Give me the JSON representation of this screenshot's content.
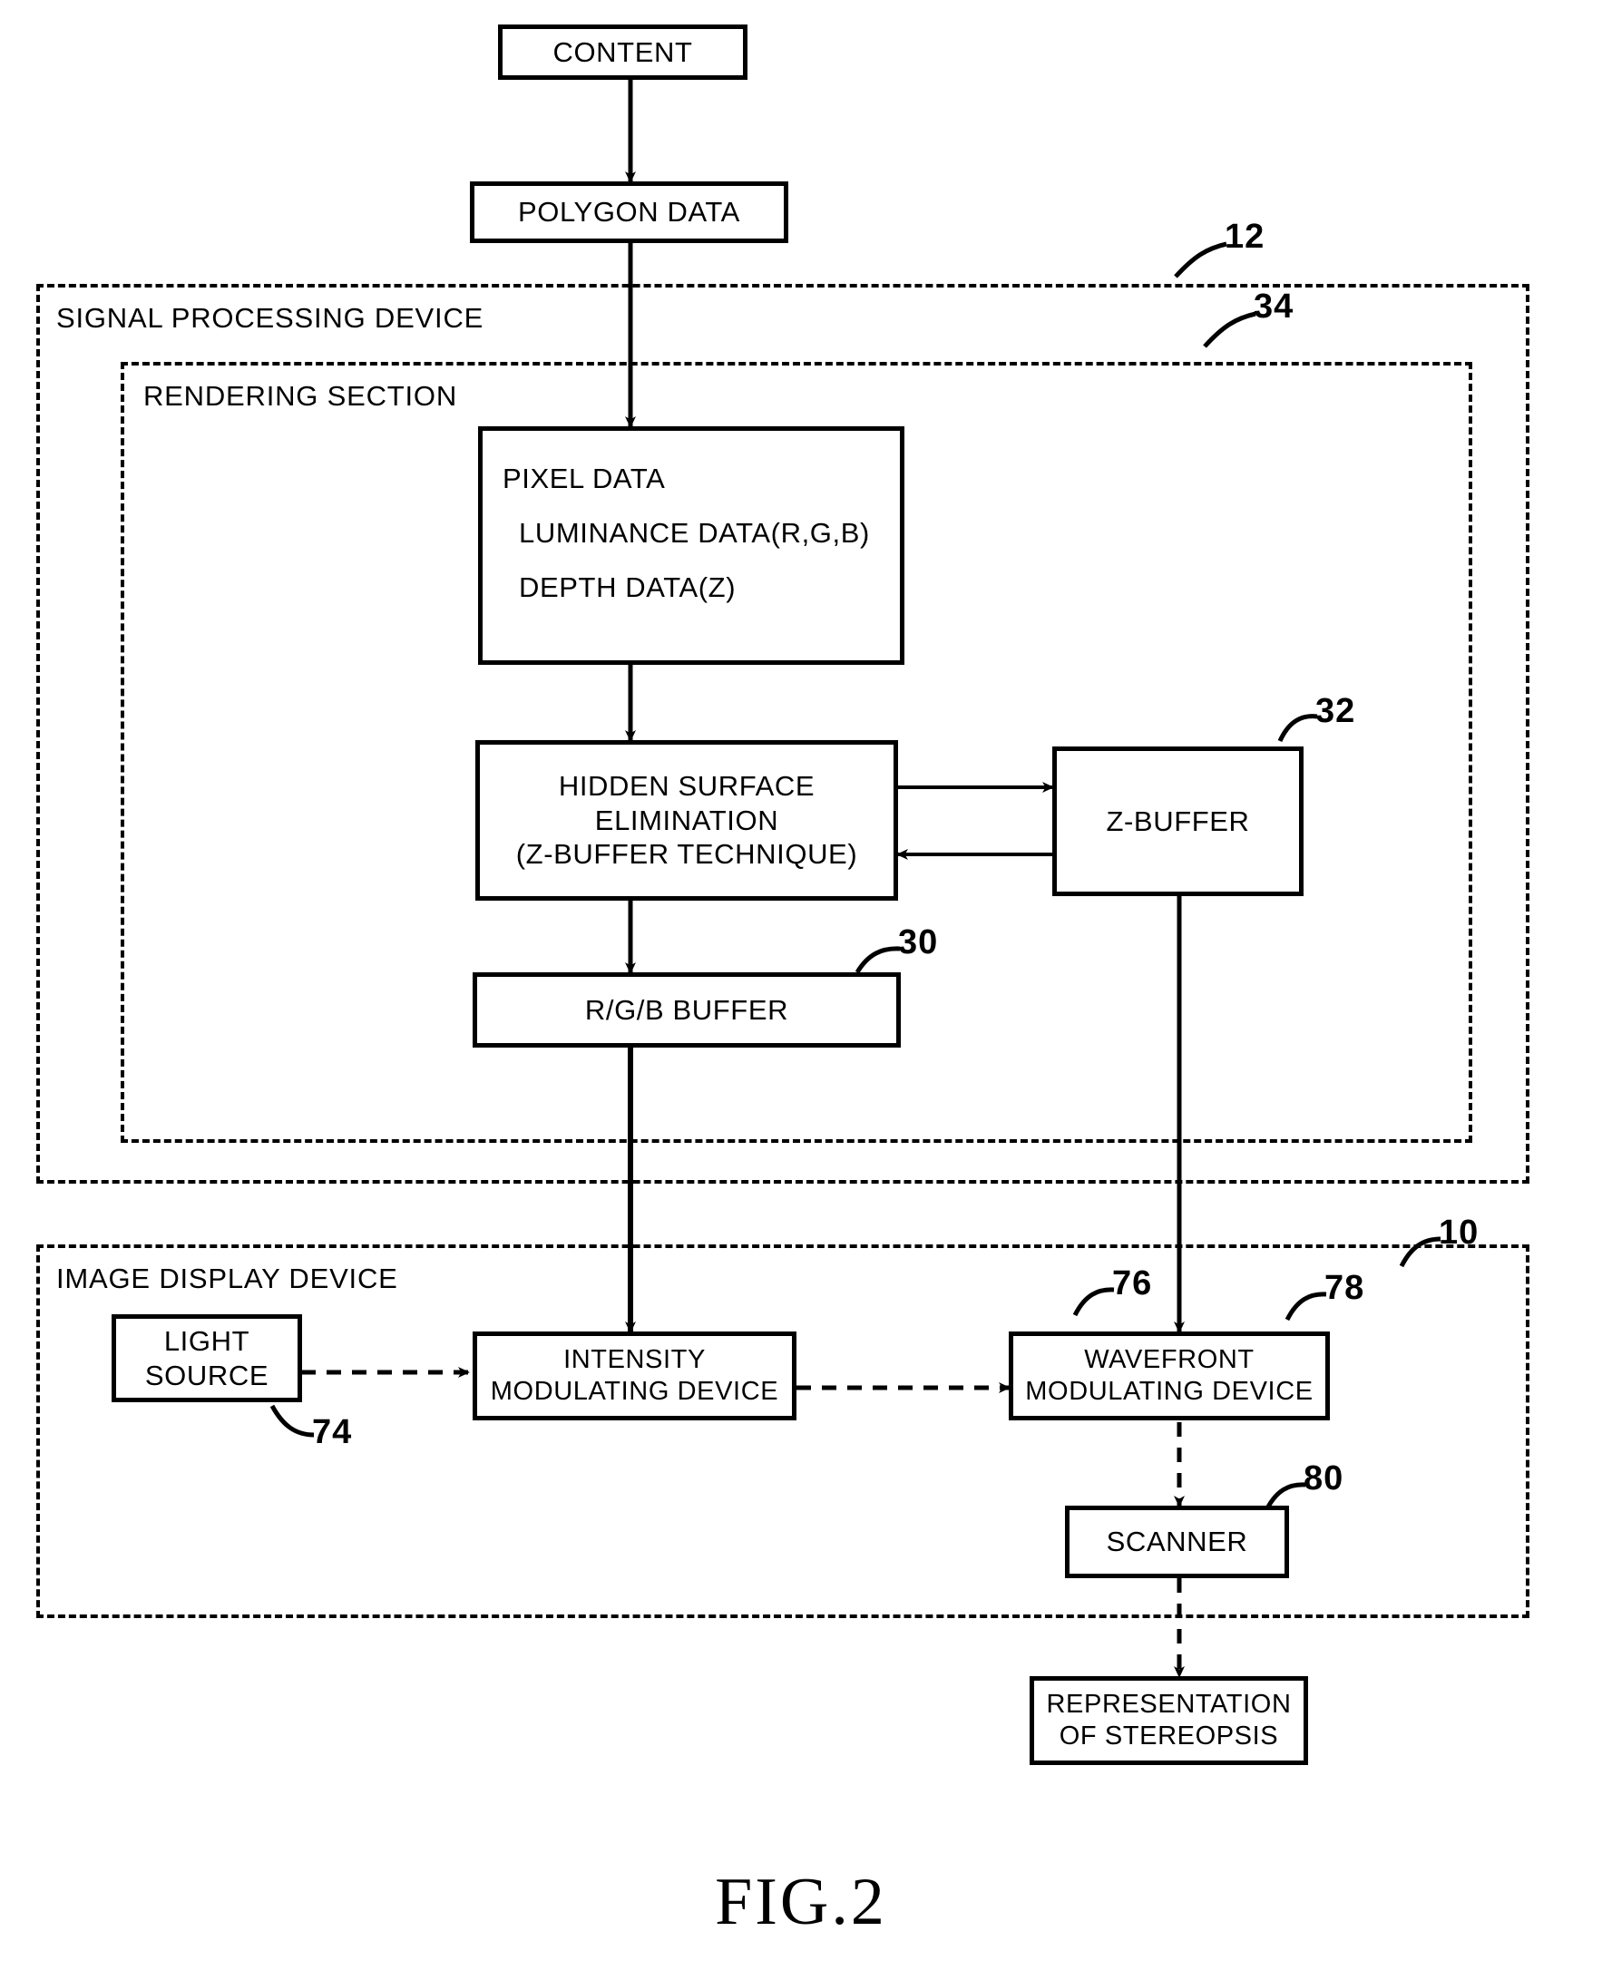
{
  "figure": {
    "caption": "FIG.2"
  },
  "enclosures": [
    {
      "id": "signal-processing-device",
      "label": "SIGNAL PROCESSING DEVICE",
      "ref": "12"
    },
    {
      "id": "rendering-section",
      "label": "RENDERING SECTION",
      "ref": "34"
    },
    {
      "id": "image-display-device",
      "label": "IMAGE DISPLAY DEVICE",
      "ref": "10"
    }
  ],
  "boxes": {
    "content": {
      "lines": [
        "CONTENT"
      ]
    },
    "polygon_data": {
      "lines": [
        "POLYGON DATA"
      ]
    },
    "pixel_data": {
      "lines": [
        "PIXEL DATA",
        "LUMINANCE DATA(R,G,B)",
        "DEPTH DATA(Z)"
      ]
    },
    "hidden_surface": {
      "lines": [
        "HIDDEN SURFACE",
        "ELIMINATION",
        "(Z-BUFFER TECHNIQUE)"
      ]
    },
    "z_buffer": {
      "lines": [
        "Z-BUFFER"
      ],
      "ref": "32"
    },
    "rgb_buffer": {
      "lines": [
        "R/G/B BUFFER"
      ],
      "ref": "30"
    },
    "light_source": {
      "lines": [
        "LIGHT",
        "SOURCE"
      ],
      "ref": "74"
    },
    "intensity_modulating": {
      "lines": [
        "INTENSITY",
        "MODULATING DEVICE"
      ],
      "ref": "76"
    },
    "wavefront_modulating": {
      "lines": [
        "WAVEFRONT",
        "MODULATING DEVICE"
      ],
      "ref": "78"
    },
    "scanner": {
      "lines": [
        "SCANNER"
      ],
      "ref": "80"
    },
    "stereopsis": {
      "lines": [
        "REPRESENTATION",
        "OF STEREOPSIS"
      ]
    }
  },
  "colors": {
    "ink": "#000000",
    "paper": "#ffffff"
  }
}
